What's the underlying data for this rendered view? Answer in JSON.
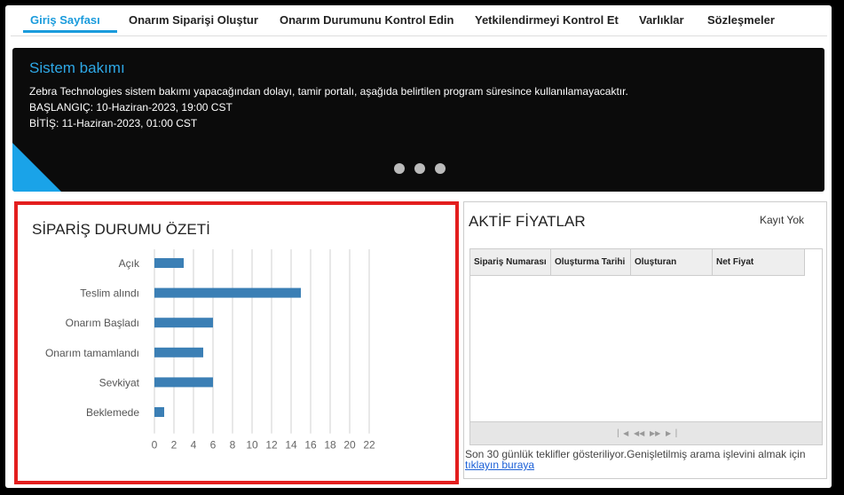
{
  "nav": {
    "tabs": [
      {
        "label": "Giriş Sayfası",
        "active": true
      },
      {
        "label": "Onarım Siparişi Oluştur"
      },
      {
        "label": "Onarım Durumunu Kontrol Edin"
      },
      {
        "label": "Yetkilendirmeyi Kontrol Et"
      },
      {
        "label": "Varlıklar"
      },
      {
        "label": "Sözleşmeler"
      }
    ]
  },
  "banner": {
    "title": "Sistem bakımı",
    "line1": "Zebra Technologies sistem bakımı yapacağından dolayı, tamir portalı, aşağıda belirtilen program süresince kullanılamayacaktır.",
    "line2": "BAŞLANGIÇ: 10-Haziran-2023, 19:00 CST",
    "line3": "BİTİŞ: 11-Haziran-2023, 01:00 CST",
    "dot_count": 3
  },
  "order_summary": {
    "title": "SİPARİŞ DURUMU ÖZETİ"
  },
  "chart_data": {
    "type": "bar",
    "orientation": "horizontal",
    "categories": [
      "Açık",
      "Teslim alındı",
      "Onarım Başladı",
      "Onarım tamamlandı",
      "Sevkiyat",
      "Beklemede"
    ],
    "values": [
      3,
      15,
      6,
      5,
      6,
      1
    ],
    "xlim": [
      0,
      22
    ],
    "xticks": [
      0,
      2,
      4,
      6,
      8,
      10,
      12,
      14,
      16,
      18,
      20,
      22
    ],
    "grid": true,
    "bar_color": "#3b7fb5"
  },
  "active_prices": {
    "title": "AKTİF FİYATLAR",
    "empty_text": "Kayıt Yok",
    "columns": [
      "Sipariş Numarası",
      "Oluşturma Tarihi",
      "Oluşturan",
      "Net Fiyat"
    ],
    "note": "Son 30 günlük teklifler gösteriliyor.Genişletilmiş arama işlevini almak için",
    "note_link": "tıklayın buraya"
  },
  "colors": {
    "accent": "#1a9bdc",
    "highlight_border": "#e31e1e",
    "banner_bg": "#0b0b0b"
  }
}
